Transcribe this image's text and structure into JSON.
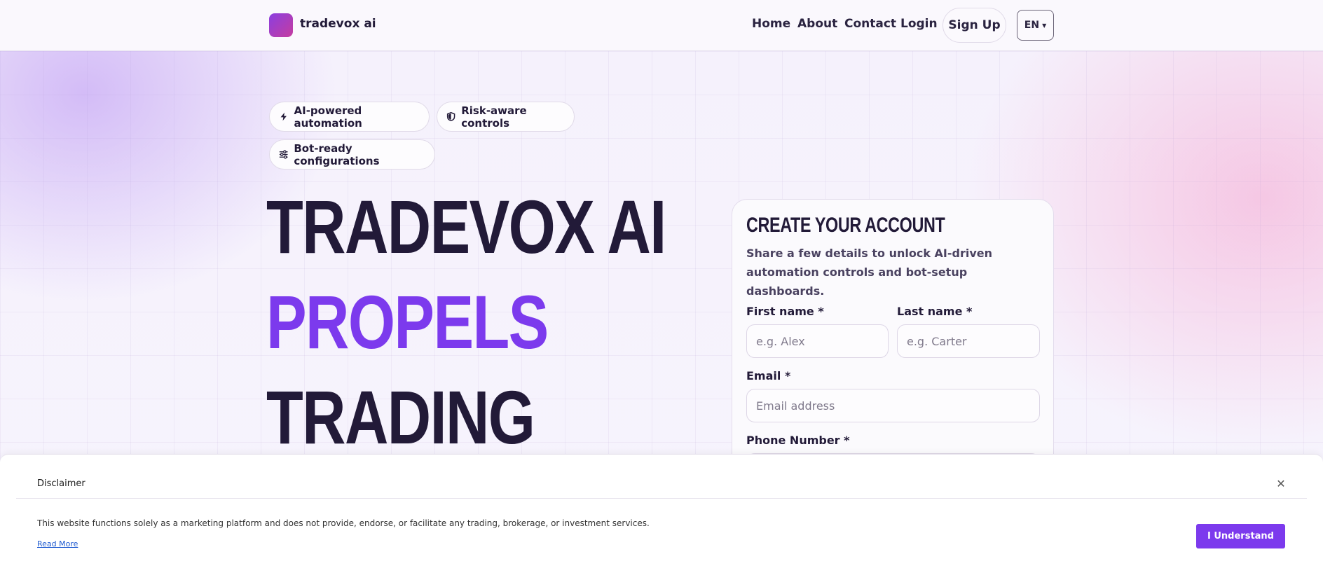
{
  "header": {
    "brand": "tradevox ai",
    "nav": {
      "home": "Home",
      "about": "About",
      "contact": "Contact",
      "login": "Login"
    },
    "signup_label": "Sign Up",
    "language": "EN",
    "icons": {
      "logo": "logo-mark",
      "language_caret": "chevron-down-icon"
    }
  },
  "chips": [
    {
      "label": "AI-powered automation",
      "icon": "lightning-icon"
    },
    {
      "label": "Risk-aware controls",
      "icon": "shield-icon"
    },
    {
      "label": "Bot-ready configurations",
      "icon": "sliders-icon"
    }
  ],
  "hero": {
    "line1": "TRADEVOX AI",
    "line2": "PROPELS",
    "line3": "TRADING"
  },
  "form": {
    "title": "CREATE YOUR ACCOUNT",
    "description": "Share a few details to unlock AI-driven automation controls and bot-setup dashboards.",
    "first_name": {
      "label": "First name *",
      "placeholder": "e.g. Alex",
      "value": ""
    },
    "last_name": {
      "label": "Last name *",
      "placeholder": "e.g. Carter",
      "value": ""
    },
    "email": {
      "label": "Email *",
      "placeholder": "Email address",
      "value": ""
    },
    "phone": {
      "label": "Phone Number *",
      "placeholder": "",
      "value": ""
    }
  },
  "disclaimer": {
    "title": "Disclaimer",
    "close_icon": "close-icon",
    "text": "This website functions solely as a marketing platform and does not provide, endorse, or facilitate any trading, brokerage, or investment services.",
    "read_more": "Read More",
    "accept_label": "I Understand"
  },
  "colors": {
    "accent": "#7c3aed",
    "text_dark": "#221a38",
    "logo_gradient_start": "#8b3fe0",
    "logo_gradient_end": "#c53c9f",
    "link": "#1e5ad0"
  }
}
